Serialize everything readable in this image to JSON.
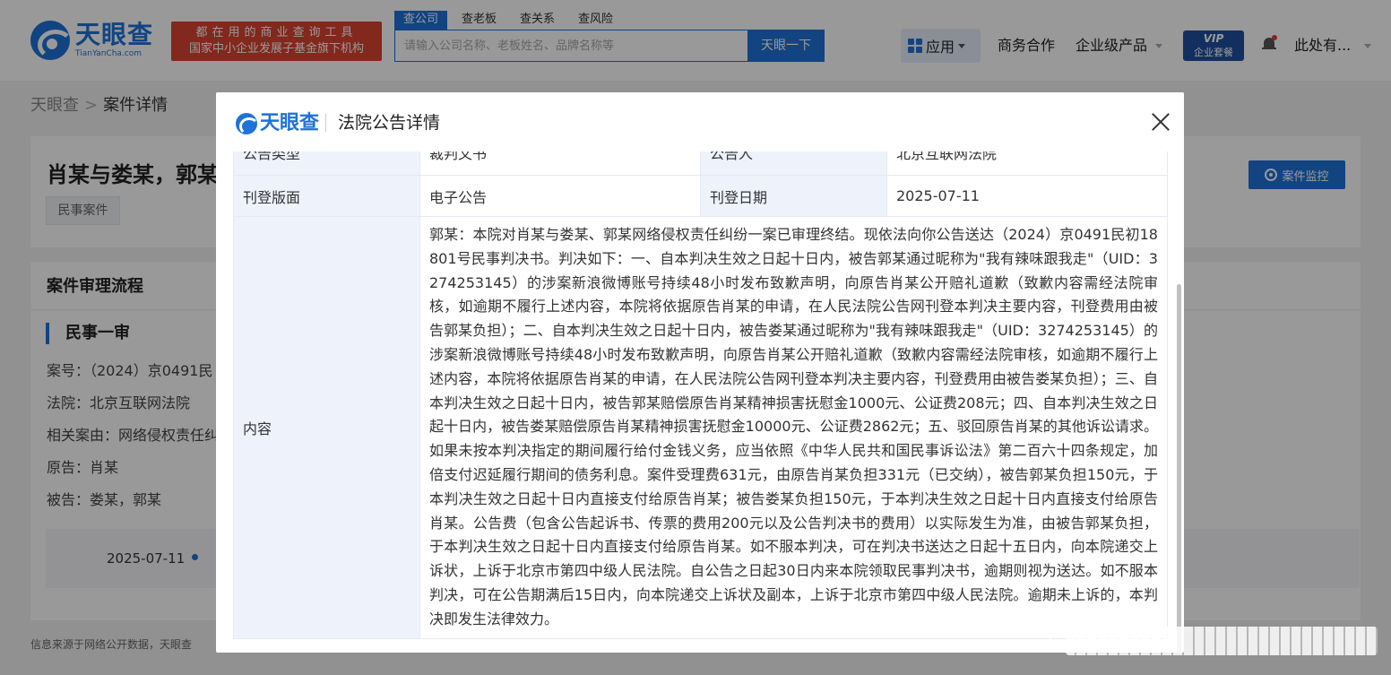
{
  "header": {
    "logo_name": "天眼查",
    "logo_domain": "TianYanCha.com",
    "slogan_line1": "都在用的商业查询工具",
    "slogan_line2": "国家中小企业发展子基金旗下机构",
    "search_tabs": [
      "查公司",
      "查老板",
      "查关系",
      "查风险"
    ],
    "search_placeholder": "请输入公司名称、老板姓名、品牌名称等",
    "search_button": "天眼一下",
    "app_menu": "应用",
    "business_link": "商务合作",
    "enterprise_link": "企业级产品",
    "vip_line1": "VIP",
    "vip_line2": "企业套餐",
    "user_name": "此处有..."
  },
  "page": {
    "breadcrumb_home": "天眼查",
    "breadcrumb_current": "案件详情",
    "case_title": "肖某与娄某，郭某",
    "case_tag": "民事案件",
    "monitor_button": "案件监控",
    "flow_title": "案件审理流程",
    "stage_title": "民事一审",
    "case_no": "案号：（2024）京0491民",
    "court": "法院：北京互联网法院",
    "cause": "相关案由：网络侵权责任纠",
    "plaintiff": "原告：肖某",
    "defendant": "被告：娄某，郭某",
    "timeline_date": "2025-07-11",
    "footer_note": "信息来源于网络公开数据，天眼查"
  },
  "modal": {
    "logo_name": "天眼查",
    "title": "法院公告详情",
    "rows": {
      "type_label": "公告类型",
      "type_value": "裁判文书",
      "announcer_label": "公告人",
      "announcer_value": "北京互联网法院",
      "layout_label": "刊登版面",
      "layout_value": "电子公告",
      "date_label": "刊登日期",
      "date_value": "2025-07-11",
      "content_label": "内容",
      "content_value": "郭某：本院对肖某与娄某、郭某网络侵权责任纠纷一案已审理终结。现依法向你公告送达（2024）京0491民初18801号民事判决书。判决如下：一、自本判决生效之日起十日内，被告郭某通过昵称为\"我有辣味跟我走\"（UID：3274253145）的涉案新浪微博账号持续48小时发布致歉声明，向原告肖某公开赔礼道歉（致歉内容需经法院审核，如逾期不履行上述内容，本院将依据原告肖某的申请，在人民法院公告网刊登本判决主要内容，刊登费用由被告郭某负担）；二、自本判决生效之日起十日内，被告娄某通过昵称为\"我有辣味跟我走\"（UID：3274253145）的涉案新浪微博账号持续48小时发布致歉声明，向原告肖某公开赔礼道歉（致歉内容需经法院审核，如逾期不履行上述内容，本院将依据原告肖某的申请，在人民法院公告网刊登本判决主要内容，刊登费用由被告娄某负担）；三、自本判决生效之日起十日内，被告郭某赔偿原告肖某精神损害抚慰金1000元、公证费208元；四、自本判决生效之日起十日内，被告娄某赔偿原告肖某精神损害抚慰金10000元、公证费2862元；五、驳回原告肖某的其他诉讼请求。如果未按本判决指定的期间履行给付金钱义务，应当依照《中华人民共和国民事诉讼法》第二百六十四条规定，加倍支付迟延履行期间的债务利息。案件受理费631元，由原告肖某负担331元（已交纳），被告郭某负担150元，于本判决生效之日起十日内直接支付给原告肖某；被告娄某负担150元，于本判决生效之日起十日内直接支付给原告肖某。公告费（包含公告起诉书、传票的费用200元以及公告判决书的费用）以实际发生为准，由被告郭某负担，于本判决生效之日起十日内直接支付给原告肖某。如不服本判决，可在判决书送达之日起十五日内，向本院递交上诉状，上诉于北京市第四中级人民法院。自公告之日起30日内来本院领取民事判决书，逾期则视为送达。如不服本判决，可在公告期满后15日内，向本院递交上诉状及副本，上诉于北京市第四中级人民法院。逾期未上诉的，本判决即发生法律效力。"
    }
  },
  "colors": {
    "brand_blue": "#1f72d8",
    "slogan_red": "#d9432f",
    "label_bg": "#eef3fb",
    "overlay": "rgba(0,0,0,0.40)"
  },
  "icons": [
    "logo-icon",
    "grid-icon",
    "caret-down-icon",
    "bell-icon",
    "monitor-icon",
    "close-icon"
  ]
}
